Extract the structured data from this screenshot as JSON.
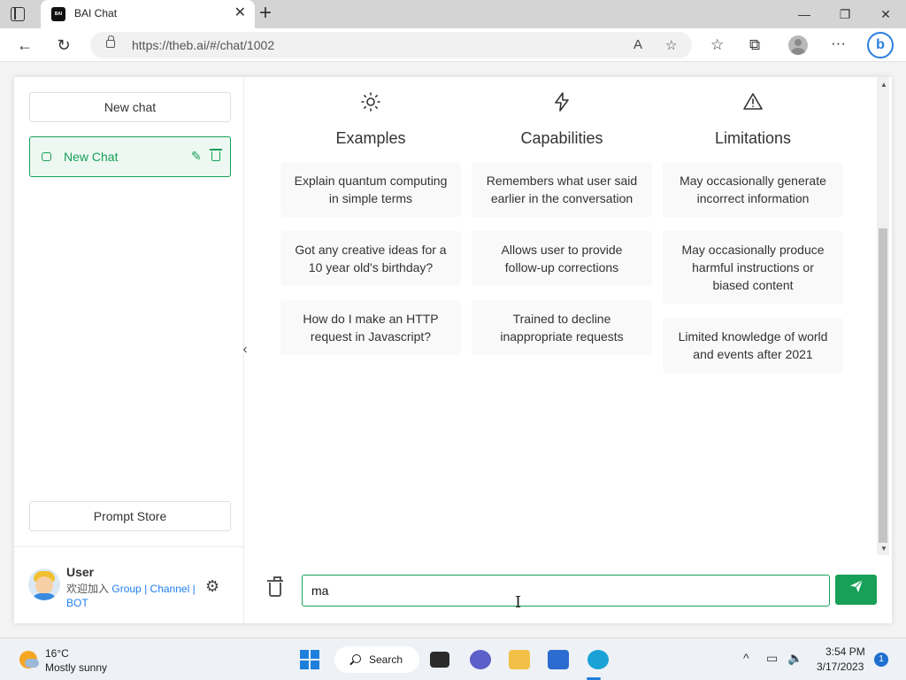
{
  "browser": {
    "tab_title": "BAI Chat",
    "favicon_text": "BAI",
    "url": "https://theb.ai/#/chat/1002"
  },
  "sidebar": {
    "new_chat_label": "New chat",
    "chat_items": [
      {
        "label": "New Chat"
      }
    ],
    "prompt_store_label": "Prompt Store",
    "user": {
      "name": "User",
      "welcome": "欢迎加入",
      "link_group": "Group",
      "link_channel": "Channel",
      "link_bot": "BOT",
      "separator": "|"
    }
  },
  "main": {
    "columns": [
      {
        "icon": "sun-icon",
        "title": "Examples",
        "cards": [
          "Explain quantum computing in simple terms",
          "Got any creative ideas for a 10 year old's birthday?",
          "How do I make an HTTP request in Javascript?"
        ]
      },
      {
        "icon": "lightning-icon",
        "title": "Capabilities",
        "cards": [
          "Remembers what user said earlier in the conversation",
          "Allows user to provide follow-up corrections",
          "Trained to decline inappropriate requests"
        ]
      },
      {
        "icon": "warning-icon",
        "title": "Limitations",
        "cards": [
          "May occasionally generate incorrect information",
          "May occasionally produce harmful instructions or biased content",
          "Limited knowledge of world and events after 2021"
        ]
      }
    ],
    "input_value": "ma"
  },
  "taskbar": {
    "temperature": "16°C",
    "condition": "Mostly sunny",
    "search_label": "Search",
    "time": "3:54 PM",
    "date": "3/17/2023",
    "notification_count": "1"
  },
  "colors": {
    "accent_green": "#18a058",
    "link_blue": "#2080f0"
  }
}
